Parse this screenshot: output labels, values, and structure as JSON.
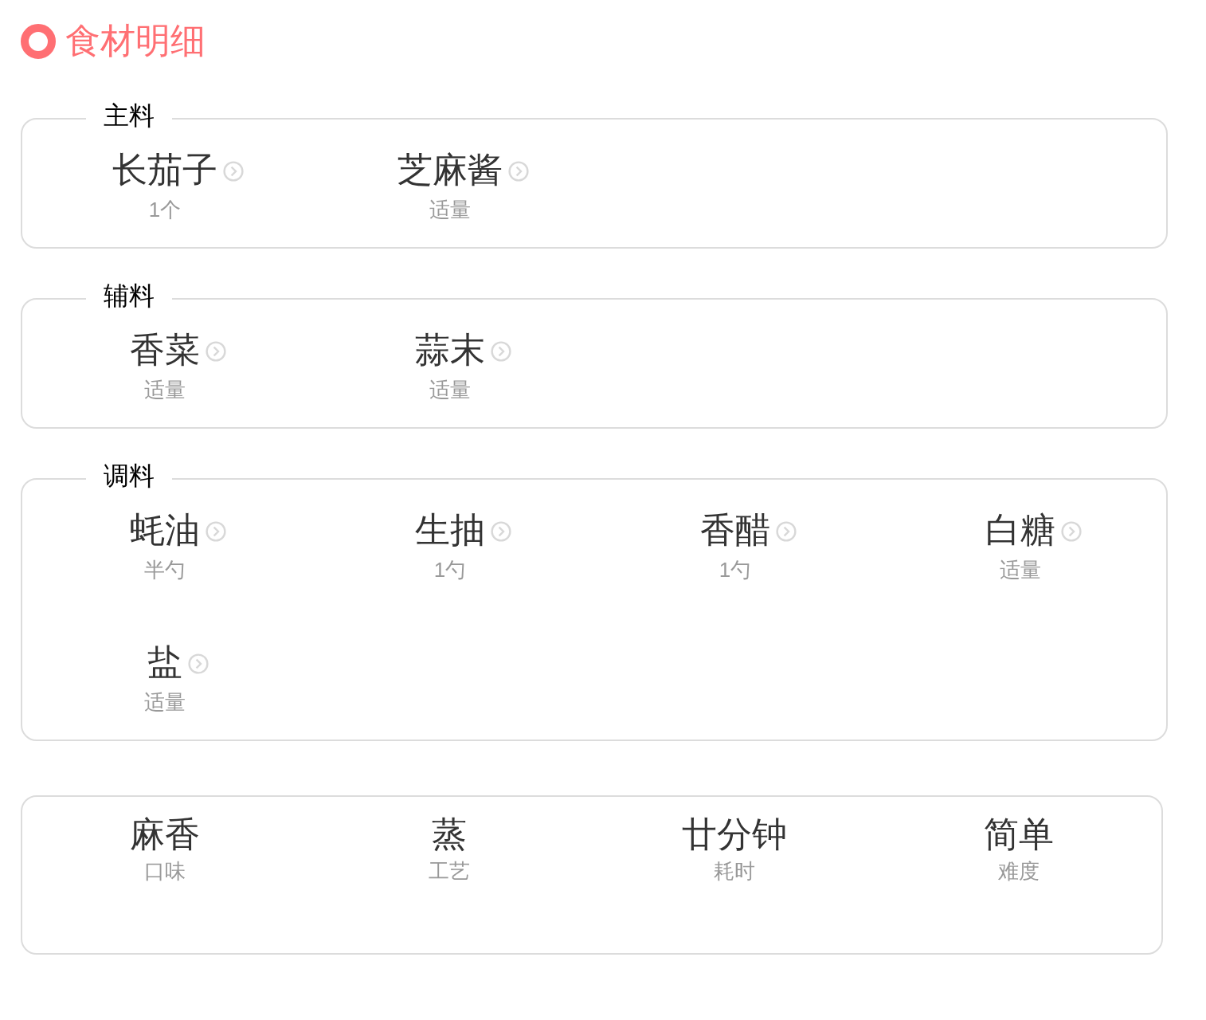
{
  "title": "食材明细",
  "groups": [
    {
      "label": "主料",
      "items": [
        {
          "name": "长茄子",
          "amount": "1个"
        },
        {
          "name": "芝麻酱",
          "amount": "适量"
        }
      ]
    },
    {
      "label": "辅料",
      "items": [
        {
          "name": "香菜",
          "amount": "适量"
        },
        {
          "name": "蒜末",
          "amount": "适量"
        }
      ]
    },
    {
      "label": "调料",
      "items": [
        {
          "name": "蚝油",
          "amount": "半勺"
        },
        {
          "name": "生抽",
          "amount": "1勺"
        },
        {
          "name": "香醋",
          "amount": "1勺"
        },
        {
          "name": "白糖",
          "amount": "适量"
        },
        {
          "name": "盐",
          "amount": "适量"
        }
      ]
    }
  ],
  "summary": [
    {
      "value": "麻香",
      "label": "口味"
    },
    {
      "value": "蒸",
      "label": "工艺"
    },
    {
      "value": "廿分钟",
      "label": "耗时"
    },
    {
      "value": "简单",
      "label": "难度"
    }
  ]
}
